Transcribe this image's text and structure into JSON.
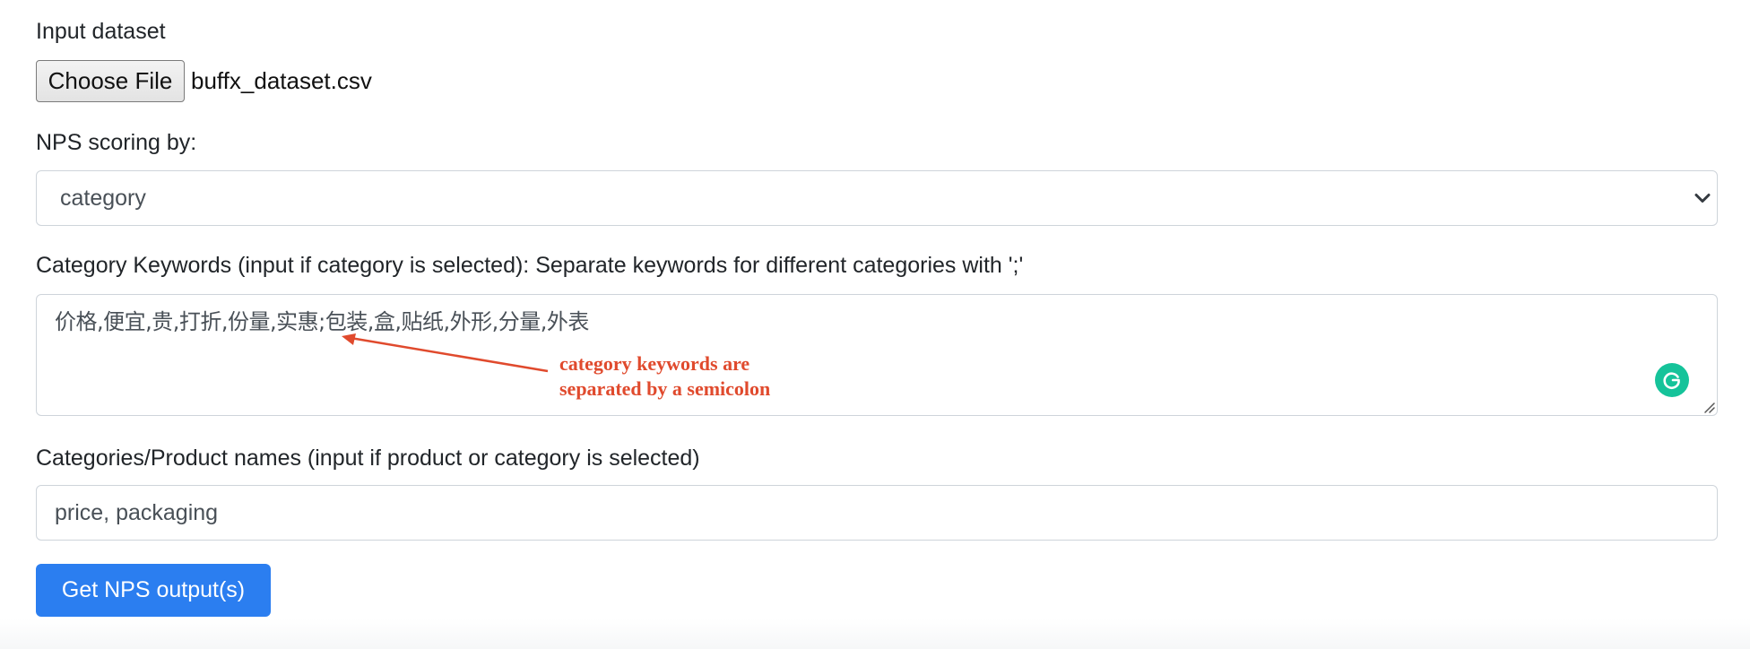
{
  "input_dataset": {
    "label": "Input dataset",
    "button_label": "Choose File",
    "file_name": "buffx_dataset.csv"
  },
  "nps_scoring": {
    "label": "NPS scoring by:",
    "selected": "category",
    "chevron_icon": "chevron-down-icon"
  },
  "category_keywords": {
    "label": "Category Keywords (input if category is selected): Separate keywords for different categories with ';'",
    "value": "价格,便宜,贵,打折,份量,实惠;包装,盒,贴纸,外形,分量,外表",
    "grammarly_icon": "grammarly-icon"
  },
  "product_names": {
    "label": "Categories/Product names (input if product or category is selected)",
    "value": "price, packaging"
  },
  "submit": {
    "label": "Get NPS output(s)"
  },
  "annotation": {
    "line1": "category keywords are",
    "line2": "separated by a semicolon",
    "color": "#e04a2d"
  },
  "colors": {
    "primary_button": "#2b7ef0",
    "grammarly": "#15c39a"
  }
}
